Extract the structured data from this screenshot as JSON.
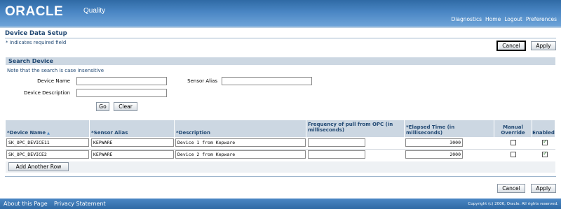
{
  "header": {
    "logo": "ORACLE",
    "app_name": "Quality",
    "links": [
      "Diagnostics",
      "Home",
      "Logout",
      "Preferences"
    ]
  },
  "page": {
    "title": "Device Data Setup",
    "required_note": "* Indicates required field",
    "cancel_label": "Cancel",
    "apply_label": "Apply"
  },
  "search": {
    "section_title": "Search Device",
    "note": "Note that the search is case insensitive",
    "device_name_label": "Device Name",
    "sensor_alias_label": "Sensor Alias",
    "device_description_label": "Device Description",
    "go_label": "Go",
    "clear_label": "Clear"
  },
  "table": {
    "columns": [
      "*Device Name",
      "*Sensor Alias",
      "*Description",
      "Frequency of pull from OPC (in milliseconds)",
      "*Elapsed Time (in milliseconds)",
      "Manual Override",
      "Enabled"
    ],
    "rows": [
      {
        "device_name": "SK_OPC_DEVICE11",
        "sensor_alias": "KEPWARE",
        "description": "Device 1 from Kepware",
        "frequency": "",
        "elapsed_time": "3000",
        "manual_override": false,
        "enabled": true
      },
      {
        "device_name": "SK_OPC_DEVICE2",
        "sensor_alias": "KEPWARE",
        "description": "Device 2 from Kepware",
        "frequency": "",
        "elapsed_time": "2000",
        "manual_override": false,
        "enabled": true
      }
    ],
    "add_row_label": "Add Another Row"
  },
  "footer": {
    "links": [
      "About this Page",
      "Privacy Statement"
    ],
    "copyright": "Copyright (c) 2006, Oracle. All rights reserved."
  }
}
